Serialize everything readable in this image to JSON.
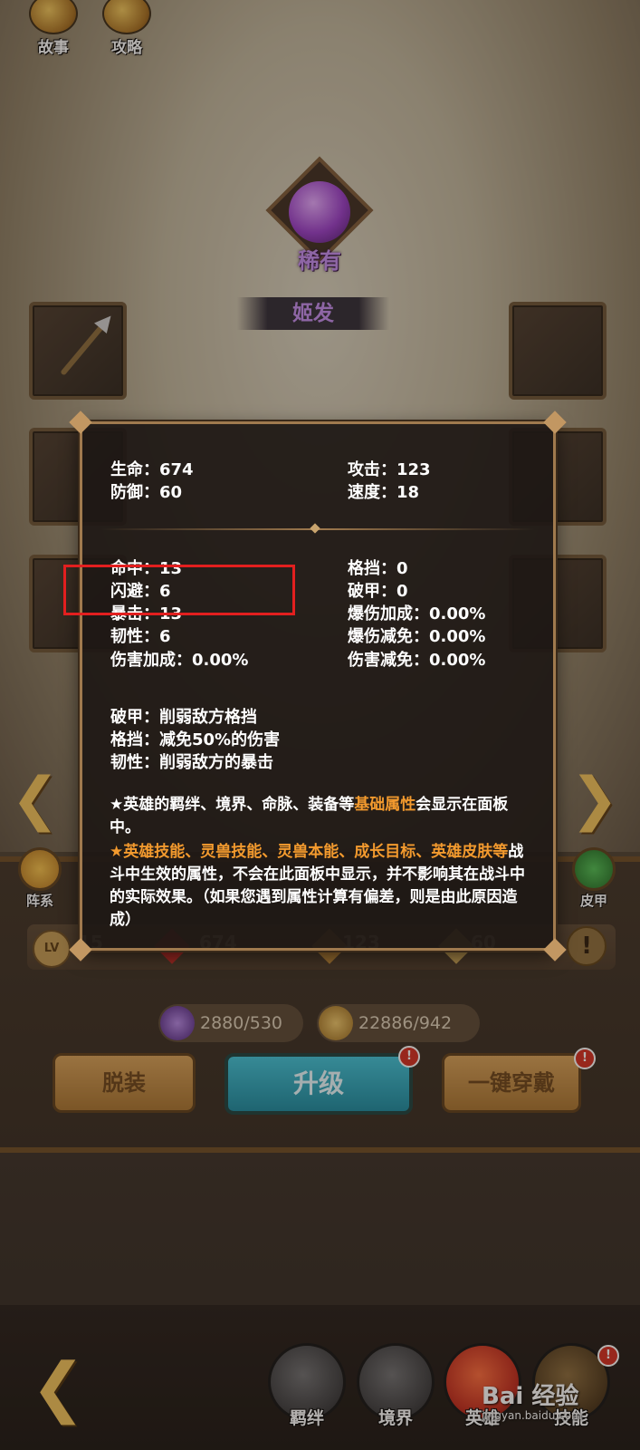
{
  "top_buttons": [
    {
      "label": "故事",
      "icon": "scroll-icon"
    },
    {
      "label": "攻略",
      "icon": "flame-book-icon"
    }
  ],
  "rarity": {
    "label": "稀有",
    "color": "#c58cf0"
  },
  "hero": {
    "name": "姬发"
  },
  "tooltip": {
    "base_stats": [
      {
        "label": "生命：674"
      },
      {
        "label": "攻击：123"
      },
      {
        "label": "防御：60"
      },
      {
        "label": "速度：18"
      }
    ],
    "adv_stats_left": [
      {
        "label": "命中：13"
      },
      {
        "label": "闪避：6"
      },
      {
        "label": "暴击：13"
      },
      {
        "label": "韧性：6"
      },
      {
        "label": "伤害加成：0.00%"
      }
    ],
    "adv_stats_right": [
      {
        "label": "格挡：0"
      },
      {
        "label": "破甲：0"
      },
      {
        "label": "爆伤加成：0.00%"
      },
      {
        "label": "爆伤减免：0.00%"
      },
      {
        "label": "伤害减免：0.00%"
      }
    ],
    "explanations": [
      "破甲：削弱敌方格挡",
      "格挡：减免50%的伤害",
      "韧性：削弱敌方的暴击"
    ],
    "note1": {
      "prefix": "★英雄的羁绊、境界、命脉、装备等",
      "highlight": "基础属性",
      "suffix": "会显示在面板中。"
    },
    "note2": {
      "highlight": "★英雄技能、灵兽技能、灵兽本能、成长目标、英雄皮肤等",
      "suffix": "战斗中生效的属性，不会在此面板中显示，并不影响其在战斗中的实际效果。（如果您遇到属性计算有偏差，则是由此原因造成）"
    }
  },
  "side_icons": {
    "left": "阵系",
    "right": "皮甲"
  },
  "stat_bar": {
    "level_badge": "LV",
    "level": "15",
    "hp": "674",
    "atk": "123",
    "def": "60"
  },
  "resources": [
    {
      "value": "2880/530",
      "icon": "purple-orb-icon"
    },
    {
      "value": "22886/942",
      "icon": "gold-coin-icon"
    }
  ],
  "actions": {
    "unequip": "脱装",
    "upgrade": "升级",
    "equip_all": "一键穿戴",
    "badge": "!"
  },
  "bottom_nav": [
    {
      "label": "羁绊"
    },
    {
      "label": "境界"
    },
    {
      "label": "英雄"
    },
    {
      "label": "技能"
    }
  ],
  "watermark": {
    "brand": "Bai 经验",
    "url": "jingyan.baidu.com"
  },
  "colors": {
    "highlight_orange": "#f39a2e",
    "annotation_red": "#e21f1f",
    "upgrade_cyan": "#2bb0c6"
  }
}
